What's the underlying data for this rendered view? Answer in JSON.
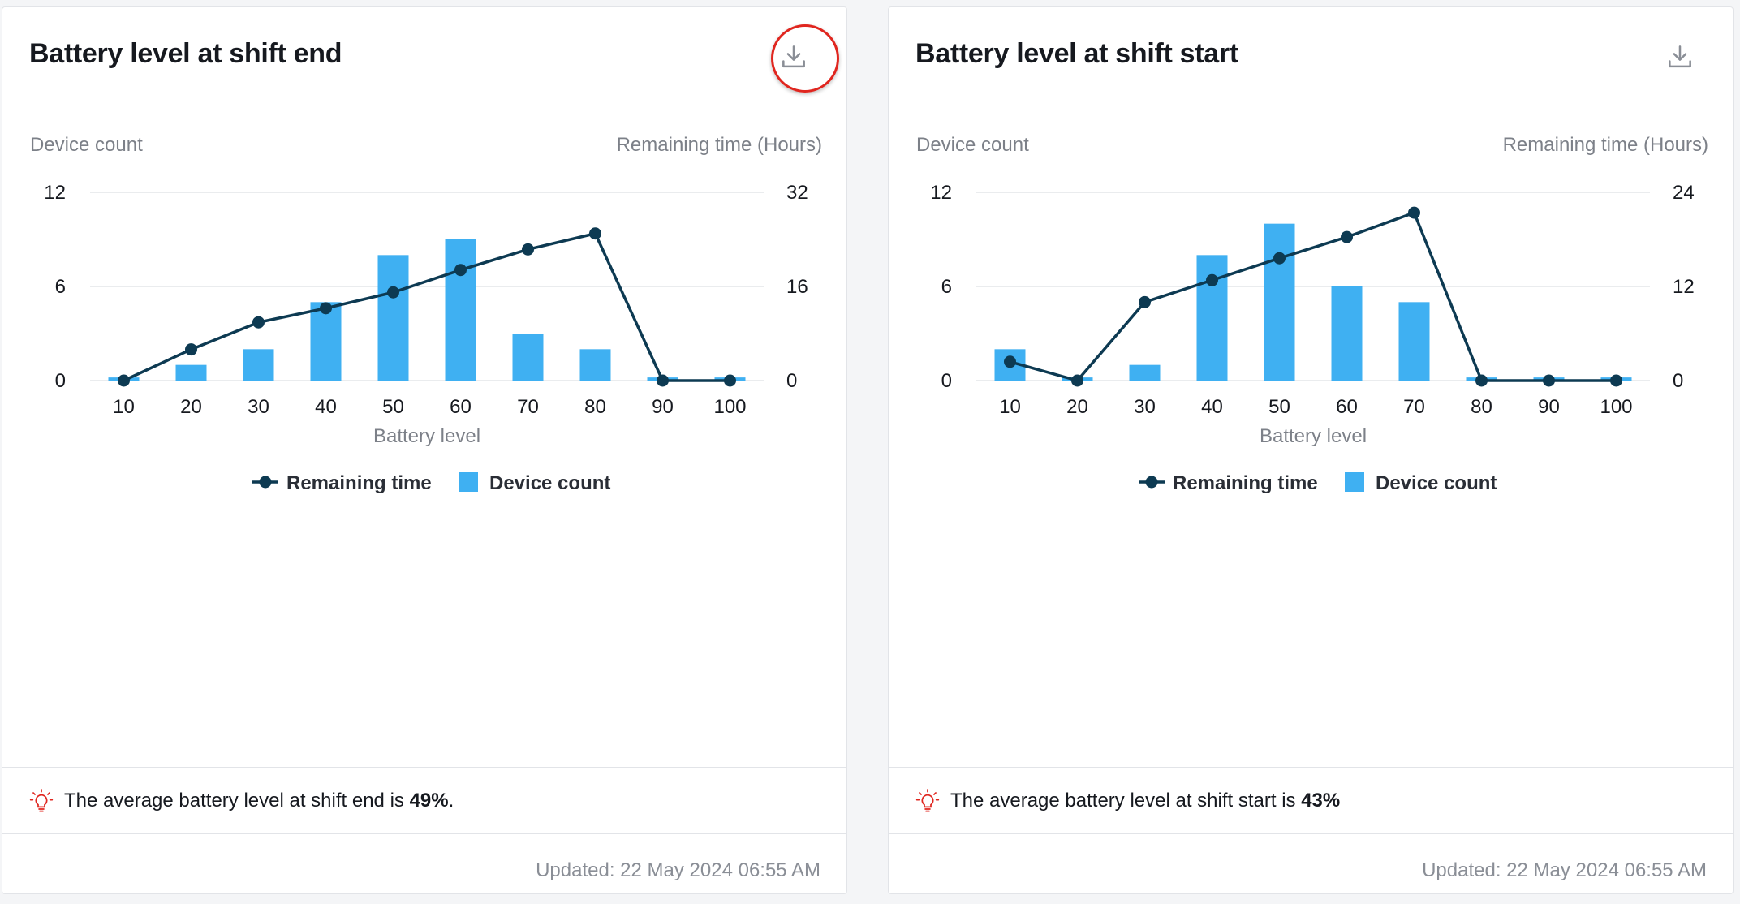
{
  "colors": {
    "bar": "#3fb0f2",
    "line": "#0d3a52",
    "grid": "#e3e5e8",
    "axis_label": "#7c8088",
    "tick": "#16191f",
    "insight_icon": "#e0261f"
  },
  "icons": {
    "download": "download-icon",
    "insight": "lightbulb-icon"
  },
  "cards": [
    {
      "title": "Battery level at shift end",
      "insight_text": "The average battery level at shift end is ",
      "insight_value": "49%",
      "insight_suffix": ".",
      "updated": "Updated: 22 May 2024 06:55 AM"
    },
    {
      "title": "Battery level at shift start",
      "insight_text": "The average battery level at shift start is ",
      "insight_value": "43%",
      "insight_suffix": "",
      "updated": "Updated: 22 May 2024 06:55 AM"
    }
  ],
  "chart_data": [
    {
      "type": "bar",
      "title": "Battery level at shift end",
      "categories": [
        "10",
        "20",
        "30",
        "40",
        "50",
        "60",
        "70",
        "80",
        "90",
        "100"
      ],
      "xlabel": "Battery level",
      "ylabel_left": "Device count",
      "ylabel_right": "Remaining time (Hours)",
      "ylim_left": [
        0,
        12
      ],
      "ylim_right": [
        0,
        32
      ],
      "yticks_left": [
        0,
        6,
        12
      ],
      "yticks_right": [
        0,
        16,
        32
      ],
      "grid": true,
      "legend_position": "bottom",
      "series": [
        {
          "name": "Remaining time",
          "type": "line",
          "axis": "right",
          "values": [
            0,
            5.3,
            9.9,
            12.3,
            15,
            18.8,
            22.3,
            25,
            0,
            0
          ]
        },
        {
          "name": "Device count",
          "type": "bar",
          "axis": "left",
          "values": [
            0.2,
            1,
            2,
            5,
            8,
            9,
            3,
            2,
            0.2,
            0.2
          ]
        }
      ]
    },
    {
      "type": "bar",
      "title": "Battery level at shift start",
      "categories": [
        "10",
        "20",
        "30",
        "40",
        "50",
        "60",
        "70",
        "80",
        "90",
        "100"
      ],
      "xlabel": "Battery level",
      "ylabel_left": "Device count",
      "ylabel_right": "Remaining time (Hours)",
      "ylim_left": [
        0,
        12
      ],
      "ylim_right": [
        0,
        24
      ],
      "yticks_left": [
        0,
        6,
        12
      ],
      "yticks_right": [
        0,
        12,
        24
      ],
      "grid": true,
      "legend_position": "bottom",
      "series": [
        {
          "name": "Remaining time",
          "type": "line",
          "axis": "right",
          "values": [
            2.4,
            0,
            10,
            12.8,
            15.6,
            18.3,
            21.4,
            0,
            0,
            0
          ]
        },
        {
          "name": "Device count",
          "type": "bar",
          "axis": "left",
          "values": [
            2,
            0.2,
            1,
            8,
            10,
            6,
            5,
            0.2,
            0.2,
            0.2
          ]
        }
      ]
    }
  ]
}
